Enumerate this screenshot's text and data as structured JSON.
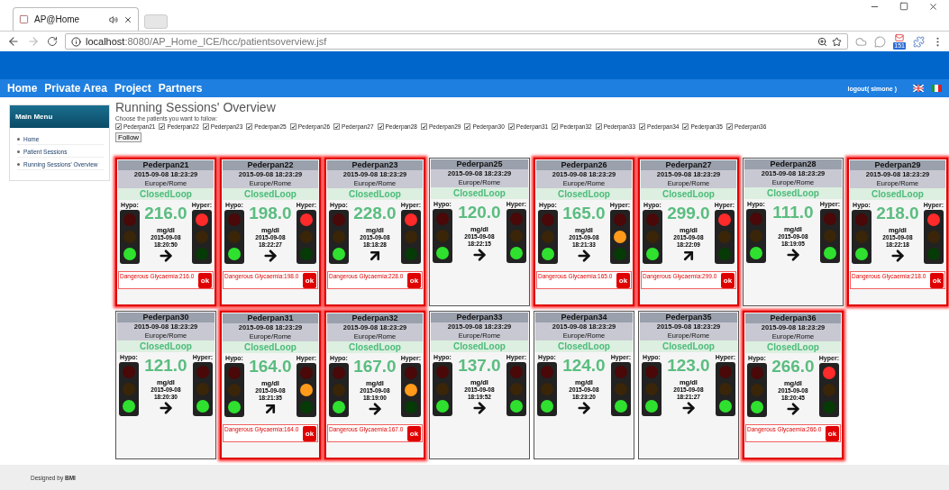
{
  "browser": {
    "tab_title": "AP@Home",
    "url_host": "localhost",
    "url_rest": ":8080/AP_Home_ICE/hcc/patientsoverview.jsf",
    "mail_count": "151"
  },
  "nav": {
    "items": [
      "Home",
      "Private Area",
      "Project",
      "Partners"
    ],
    "logout": "logout( simone )"
  },
  "sidebar": {
    "title": "Main Menu",
    "items": [
      "Home",
      "Patient Sessions",
      "Running Sessions' Overview"
    ]
  },
  "page": {
    "title": "Running Sessions' Overview",
    "prompt": "Choose the patients you want to follow:",
    "follow_button": "Follow"
  },
  "patient_checkboxes": [
    {
      "label": "Pederpan21",
      "checked": true
    },
    {
      "label": "Pederpan22",
      "checked": true
    },
    {
      "label": "Pederpan23",
      "checked": true
    },
    {
      "label": "Pederpan25",
      "checked": true
    },
    {
      "label": "Pederpan26",
      "checked": true
    },
    {
      "label": "Pederpan27",
      "checked": true
    },
    {
      "label": "Pederpan28",
      "checked": true
    },
    {
      "label": "Pederpan29",
      "checked": true
    },
    {
      "label": "Pederpan30",
      "checked": true
    },
    {
      "label": "Pederpan31",
      "checked": true
    },
    {
      "label": "Pederpan32",
      "checked": true
    },
    {
      "label": "Pederpan33",
      "checked": true
    },
    {
      "label": "Pederpan34",
      "checked": true
    },
    {
      "label": "Pederpan35",
      "checked": true
    },
    {
      "label": "Pederpan36",
      "checked": true
    }
  ],
  "sessions": [
    {
      "name": "Pederpan21",
      "datetime": "2015-09-08 18:23:29",
      "timezone": "Europe/Rome",
      "mode": "ClosedLoop",
      "hypo_label": "Hypo:",
      "hyper_label": "Hyper:",
      "value": "216.0",
      "unit": "mg/dl",
      "date": "2015-09-08",
      "time": "18:20:50",
      "hypo_lamps": {
        "red": false,
        "yellow": false,
        "green": true
      },
      "hyper_lamps": {
        "red": true,
        "yellow": false,
        "green": false
      },
      "rising": false,
      "alarm": true,
      "alert": "Dangerous Glycaemia:216.0",
      "ok": "ok"
    },
    {
      "name": "Pederpan22",
      "datetime": "2015-09-08 18:23:29",
      "timezone": "Europe/Rome",
      "mode": "ClosedLoop",
      "hypo_label": "Hypo:",
      "hyper_label": "Hyper:",
      "value": "198.0",
      "unit": "mg/dl",
      "date": "2015-09-08",
      "time": "18:22:27",
      "hypo_lamps": {
        "red": false,
        "yellow": false,
        "green": true
      },
      "hyper_lamps": {
        "red": true,
        "yellow": false,
        "green": false
      },
      "rising": false,
      "alarm": true,
      "alert": "Dangerous Glycaemia:198.0",
      "ok": "ok"
    },
    {
      "name": "Pederpan23",
      "datetime": "2015-09-08 18:23:29",
      "timezone": "Europe/Rome",
      "mode": "ClosedLoop",
      "hypo_label": "Hypo:",
      "hyper_label": "Hyper:",
      "value": "228.0",
      "unit": "mg/dl",
      "date": "2015-09-08",
      "time": "18:18:28",
      "hypo_lamps": {
        "red": false,
        "yellow": false,
        "green": true
      },
      "hyper_lamps": {
        "red": true,
        "yellow": false,
        "green": false
      },
      "rising": true,
      "alarm": true,
      "alert": "Dangerous Glycaemia:228.0",
      "ok": "ok"
    },
    {
      "name": "Pederpan25",
      "datetime": "2015-09-08 18:23:29",
      "timezone": "Europe/Rome",
      "mode": "ClosedLoop",
      "hypo_label": "Hypo:",
      "hyper_label": "Hyper:",
      "value": "120.0",
      "unit": "mg/dl",
      "date": "2015-09-08",
      "time": "18:22:15",
      "hypo_lamps": {
        "red": false,
        "yellow": false,
        "green": true
      },
      "hyper_lamps": {
        "red": false,
        "yellow": false,
        "green": true
      },
      "rising": false,
      "alarm": false
    },
    {
      "name": "Pederpan26",
      "datetime": "2015-09-08 18:23:29",
      "timezone": "Europe/Rome",
      "mode": "ClosedLoop",
      "hypo_label": "Hypo:",
      "hyper_label": "Hyper:",
      "value": "165.0",
      "unit": "mg/dl",
      "date": "2015-09-08",
      "time": "18:21:33",
      "hypo_lamps": {
        "red": false,
        "yellow": false,
        "green": true
      },
      "hyper_lamps": {
        "red": false,
        "yellow": true,
        "green": false
      },
      "rising": false,
      "alarm": true,
      "alert": "Dangerous Glycaemia:165.0",
      "ok": "ok"
    },
    {
      "name": "Pederpan27",
      "datetime": "2015-09-08 18:23:29",
      "timezone": "Europe/Rome",
      "mode": "ClosedLoop",
      "hypo_label": "Hypo:",
      "hyper_label": "Hyper:",
      "value": "299.0",
      "unit": "mg/dl",
      "date": "2015-09-08",
      "time": "18:22:09",
      "hypo_lamps": {
        "red": false,
        "yellow": false,
        "green": true
      },
      "hyper_lamps": {
        "red": true,
        "yellow": false,
        "green": false
      },
      "rising": true,
      "alarm": true,
      "alert": "Dangerous Glycaemia:299.0",
      "ok": "ok"
    },
    {
      "name": "Pederpan28",
      "datetime": "2015-09-08 18:23:29",
      "timezone": "Europe/Rome",
      "mode": "ClosedLoop",
      "hypo_label": "Hypo:",
      "hyper_label": "Hyper:",
      "value": "111.0",
      "unit": "mg/dl",
      "date": "2015-09-08",
      "time": "18:19:05",
      "hypo_lamps": {
        "red": false,
        "yellow": false,
        "green": true
      },
      "hyper_lamps": {
        "red": false,
        "yellow": false,
        "green": true
      },
      "rising": false,
      "alarm": false
    },
    {
      "name": "Pederpan29",
      "datetime": "2015-09-08 18:23:29",
      "timezone": "Europe/Rome",
      "mode": "ClosedLoop",
      "hypo_label": "Hypo:",
      "hyper_label": "Hyper:",
      "value": "218.0",
      "unit": "mg/dl",
      "date": "2015-09-08",
      "time": "18:22:18",
      "hypo_lamps": {
        "red": false,
        "yellow": false,
        "green": true
      },
      "hyper_lamps": {
        "red": true,
        "yellow": false,
        "green": false
      },
      "rising": false,
      "alarm": true,
      "alert": "Dangerous Glycaemia:218.0",
      "ok": "ok"
    },
    {
      "name": "Pederpan30",
      "datetime": "2015-09-08 18:23:29",
      "timezone": "Europe/Rome",
      "mode": "ClosedLoop",
      "hypo_label": "Hypo:",
      "hyper_label": "Hyper:",
      "value": "121.0",
      "unit": "mg/dl",
      "date": "2015-09-08",
      "time": "18:20:30",
      "hypo_lamps": {
        "red": false,
        "yellow": false,
        "green": true
      },
      "hyper_lamps": {
        "red": false,
        "yellow": false,
        "green": true
      },
      "rising": false,
      "alarm": false
    },
    {
      "name": "Pederpan31",
      "datetime": "2015-09-08 18:23:29",
      "timezone": "Europe/Rome",
      "mode": "ClosedLoop",
      "hypo_label": "Hypo:",
      "hyper_label": "Hyper:",
      "value": "164.0",
      "unit": "mg/dl",
      "date": "2015-09-08",
      "time": "18:21:35",
      "hypo_lamps": {
        "red": false,
        "yellow": false,
        "green": true
      },
      "hyper_lamps": {
        "red": false,
        "yellow": true,
        "green": false
      },
      "rising": true,
      "alarm": true,
      "alert": "Dangerous Glycaemia:164.0",
      "ok": "ok"
    },
    {
      "name": "Pederpan32",
      "datetime": "2015-09-08 18:23:29",
      "timezone": "Europe/Rome",
      "mode": "ClosedLoop",
      "hypo_label": "Hypo:",
      "hyper_label": "Hyper:",
      "value": "167.0",
      "unit": "mg/dl",
      "date": "2015-09-08",
      "time": "18:19:00",
      "hypo_lamps": {
        "red": false,
        "yellow": false,
        "green": true
      },
      "hyper_lamps": {
        "red": false,
        "yellow": true,
        "green": false
      },
      "rising": false,
      "alarm": true,
      "alert": "Dangerous Glycaemia:167.0",
      "ok": "ok"
    },
    {
      "name": "Pederpan33",
      "datetime": "2015-09-08 18:23:29",
      "timezone": "Europe/Rome",
      "mode": "ClosedLoop",
      "hypo_label": "Hypo:",
      "hyper_label": "Hyper:",
      "value": "137.0",
      "unit": "mg/dl",
      "date": "2015-09-08",
      "time": "18:19:52",
      "hypo_lamps": {
        "red": false,
        "yellow": false,
        "green": true
      },
      "hyper_lamps": {
        "red": false,
        "yellow": false,
        "green": true
      },
      "rising": false,
      "alarm": false
    },
    {
      "name": "Pederpan34",
      "datetime": "2015-09-08 18:23:29",
      "timezone": "Europe/Rome",
      "mode": "ClosedLoop",
      "hypo_label": "Hypo:",
      "hyper_label": "Hyper:",
      "value": "124.0",
      "unit": "mg/dl",
      "date": "2015-09-08",
      "time": "18:23:20",
      "hypo_lamps": {
        "red": false,
        "yellow": false,
        "green": true
      },
      "hyper_lamps": {
        "red": false,
        "yellow": false,
        "green": true
      },
      "rising": false,
      "alarm": false
    },
    {
      "name": "Pederpan35",
      "datetime": "2015-09-08 18:23:29",
      "timezone": "Europe/Rome",
      "mode": "ClosedLoop",
      "hypo_label": "Hypo:",
      "hyper_label": "Hyper:",
      "value": "123.0",
      "unit": "mg/dl",
      "date": "2015-09-08",
      "time": "18:21:27",
      "hypo_lamps": {
        "red": false,
        "yellow": false,
        "green": true
      },
      "hyper_lamps": {
        "red": false,
        "yellow": false,
        "green": true
      },
      "rising": false,
      "alarm": false
    },
    {
      "name": "Pederpan36",
      "datetime": "2015-09-08 18:23:29",
      "timezone": "Europe/Rome",
      "mode": "ClosedLoop",
      "hypo_label": "Hypo:",
      "hyper_label": "Hyper:",
      "value": "266.0",
      "unit": "mg/dl",
      "date": "2015-09-08",
      "time": "18:20:45",
      "hypo_lamps": {
        "red": false,
        "yellow": false,
        "green": true
      },
      "hyper_lamps": {
        "red": true,
        "yellow": false,
        "green": false
      },
      "rising": false,
      "alarm": true,
      "alert": "Dangerous Glycaemia:266.0",
      "ok": "ok"
    }
  ],
  "footer": {
    "text": "Designed by **BMI**"
  }
}
